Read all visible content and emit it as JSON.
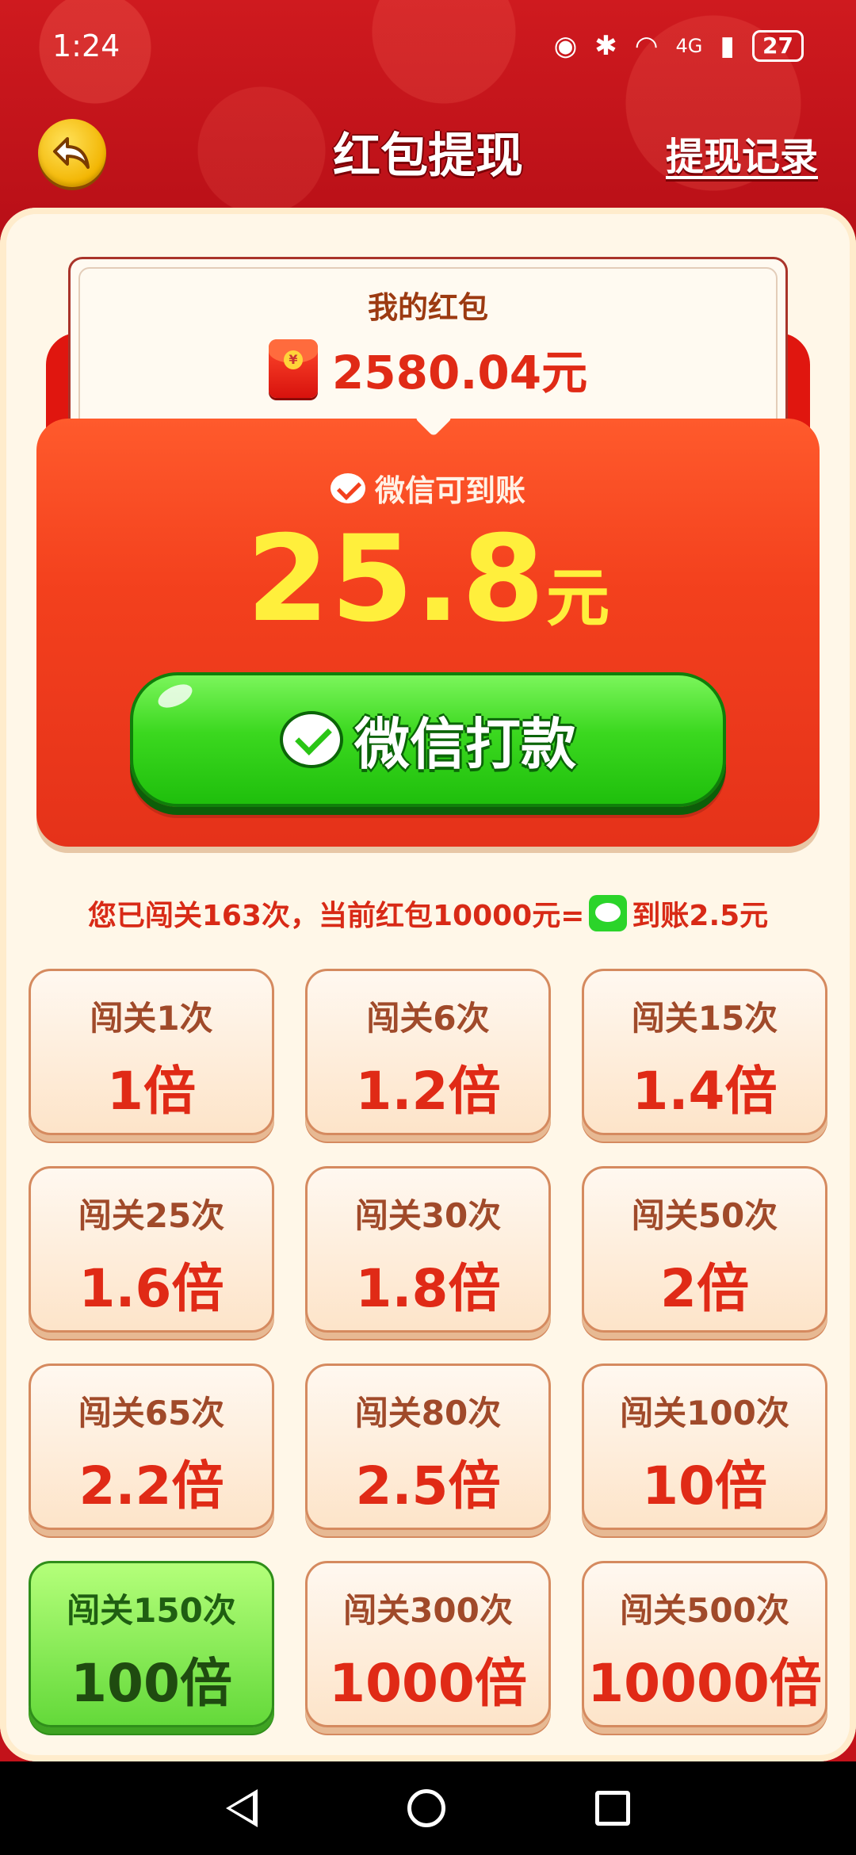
{
  "status_bar": {
    "time": "1:24",
    "network": "4G",
    "battery": "27"
  },
  "header": {
    "title": "红包提现",
    "records_link": "提现记录"
  },
  "balance": {
    "label": "我的红包",
    "amount": "2580.04元",
    "icon": "red-packet-icon"
  },
  "payout": {
    "channel_label": "微信可到账",
    "amount_number": "25.8",
    "amount_unit": "元",
    "button_label": "微信打款"
  },
  "info": {
    "prefix": "您已闯关163次，当前红包10000元=",
    "suffix": "到账2.5元"
  },
  "tiers": [
    {
      "label": "闯关1次",
      "multiplier": "1倍"
    },
    {
      "label": "闯关6次",
      "multiplier": "1.2倍"
    },
    {
      "label": "闯关15次",
      "multiplier": "1.4倍"
    },
    {
      "label": "闯关25次",
      "multiplier": "1.6倍"
    },
    {
      "label": "闯关30次",
      "multiplier": "1.8倍"
    },
    {
      "label": "闯关50次",
      "multiplier": "2倍"
    },
    {
      "label": "闯关65次",
      "multiplier": "2.2倍"
    },
    {
      "label": "闯关80次",
      "multiplier": "2.5倍"
    },
    {
      "label": "闯关100次",
      "multiplier": "10倍"
    },
    {
      "label": "闯关150次",
      "multiplier": "100倍"
    },
    {
      "label": "闯关300次",
      "multiplier": "1000倍"
    },
    {
      "label": "闯关500次",
      "multiplier": "10000倍"
    }
  ],
  "active_tier_index": 9,
  "colors": {
    "primary_red": "#e02a16",
    "wechat_green": "#2bd42a",
    "amount_yellow": "#ffef3c",
    "panel_bg": "#fff7e8"
  }
}
